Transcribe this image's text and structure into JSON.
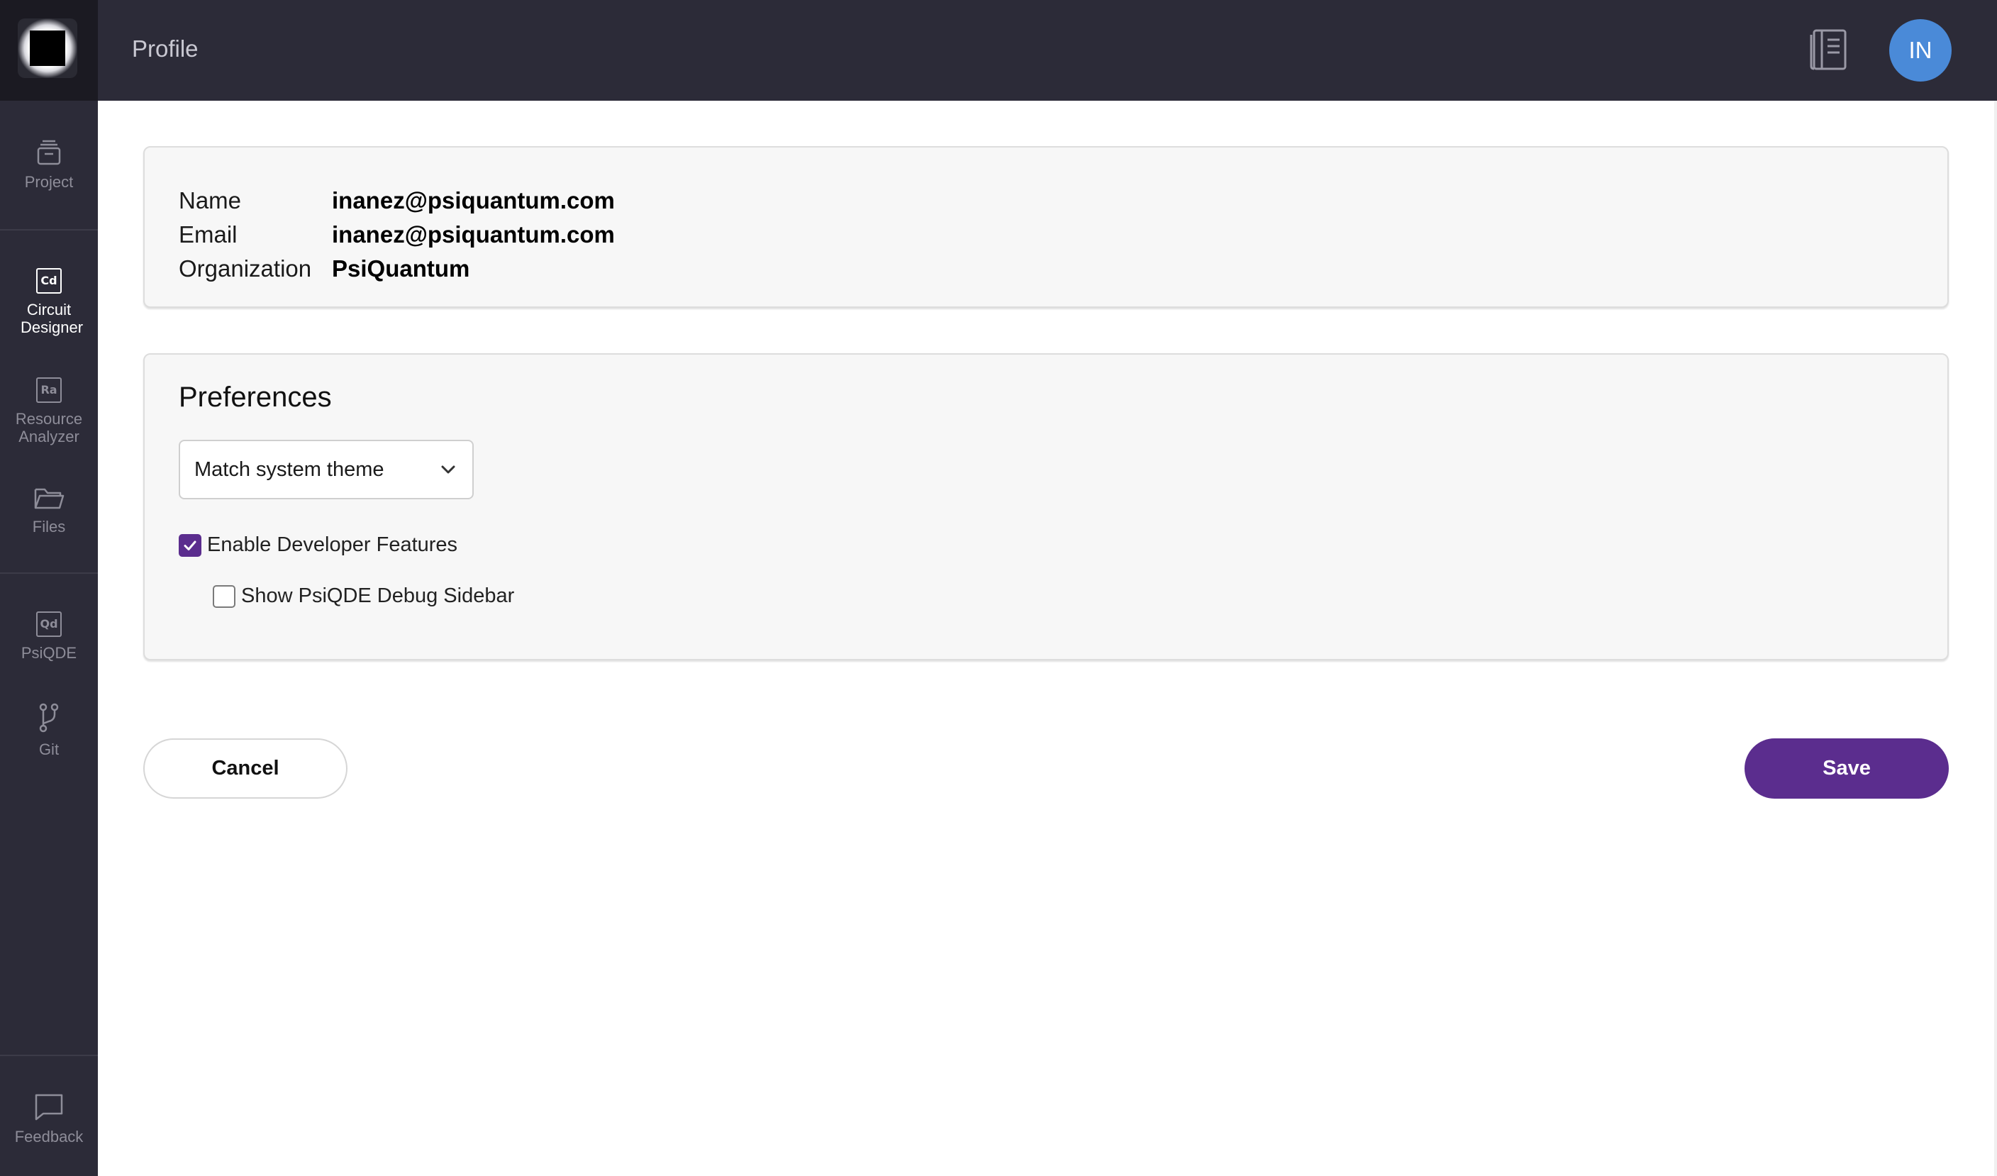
{
  "header": {
    "title": "Profile",
    "avatar_initials": "IN",
    "docs_icon": "book-icon"
  },
  "sidebar": {
    "items": [
      {
        "label": "Project",
        "icon": "project-stack-icon"
      },
      {
        "label": "Circuit Designer",
        "badge": "Cd",
        "active": true
      },
      {
        "label": "Resource Analyzer",
        "badge": "Ra"
      },
      {
        "label": "Files",
        "icon": "folder-icon"
      },
      {
        "label": "PsiQDE",
        "badge": "Qd"
      },
      {
        "label": "Git",
        "icon": "git-branch-icon"
      }
    ],
    "footer": {
      "label": "Feedback",
      "icon": "chat-bubble-icon"
    }
  },
  "profile": {
    "fields": [
      {
        "label": "Name",
        "value": "inanez@psiquantum.com"
      },
      {
        "label": "Email",
        "value": "inanez@psiquantum.com"
      },
      {
        "label": "Organization",
        "value": "PsiQuantum"
      }
    ]
  },
  "preferences": {
    "title": "Preferences",
    "theme_select": "Match system theme",
    "enable_dev": {
      "label": "Enable Developer Features",
      "checked": true
    },
    "debug_sidebar": {
      "label": "Show PsiQDE Debug Sidebar",
      "checked": false
    }
  },
  "actions": {
    "cancel_label": "Cancel",
    "save_label": "Save"
  },
  "colors": {
    "accent": "#5b2d8e",
    "rail": "#2c2b38",
    "avatar": "#4a8ad8"
  }
}
